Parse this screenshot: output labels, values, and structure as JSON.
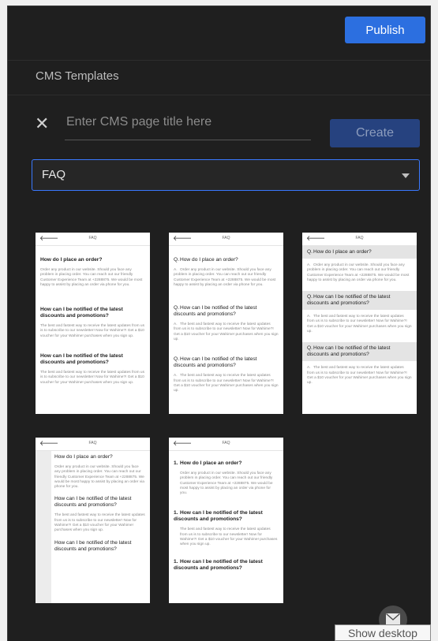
{
  "header": {
    "publish_label": "Publish"
  },
  "section": {
    "title": "CMS Templates"
  },
  "create_form": {
    "placeholder": "Enter CMS page title here",
    "create_label": "Create"
  },
  "template_select": {
    "value": "FAQ"
  },
  "thumb_common": {
    "back": "🡐",
    "title": "FAQ",
    "q1": "How do I place an order?",
    "a1": "Order any product in our website. Should you face any problem in placing order. You can reach out our friendly Customer Experience Team at +2288875. We would be most happy to assist by placing an order via phone for you.",
    "q2": "How can I be notified of the latest discounts and promotions?",
    "a2": "The best and fastest way to receive the latest updates from us is to subscribe to our newsletter! Now for Wahime?! Get a $10 voucher for your Wahime! purchases when you sign up.",
    "q3": "How can I be notified of the latest discounts and promotions?",
    "a3": "The best and fastest way to receive the latest updates from us is to subscribe to our newsletter! Now for Wahime?! Get a $10 voucher for your Wahime! purchases when you sign up.",
    "qmark": "Q.",
    "amark": "A.",
    "n1": "1."
  },
  "tooltip": {
    "text": "Show desktop"
  }
}
